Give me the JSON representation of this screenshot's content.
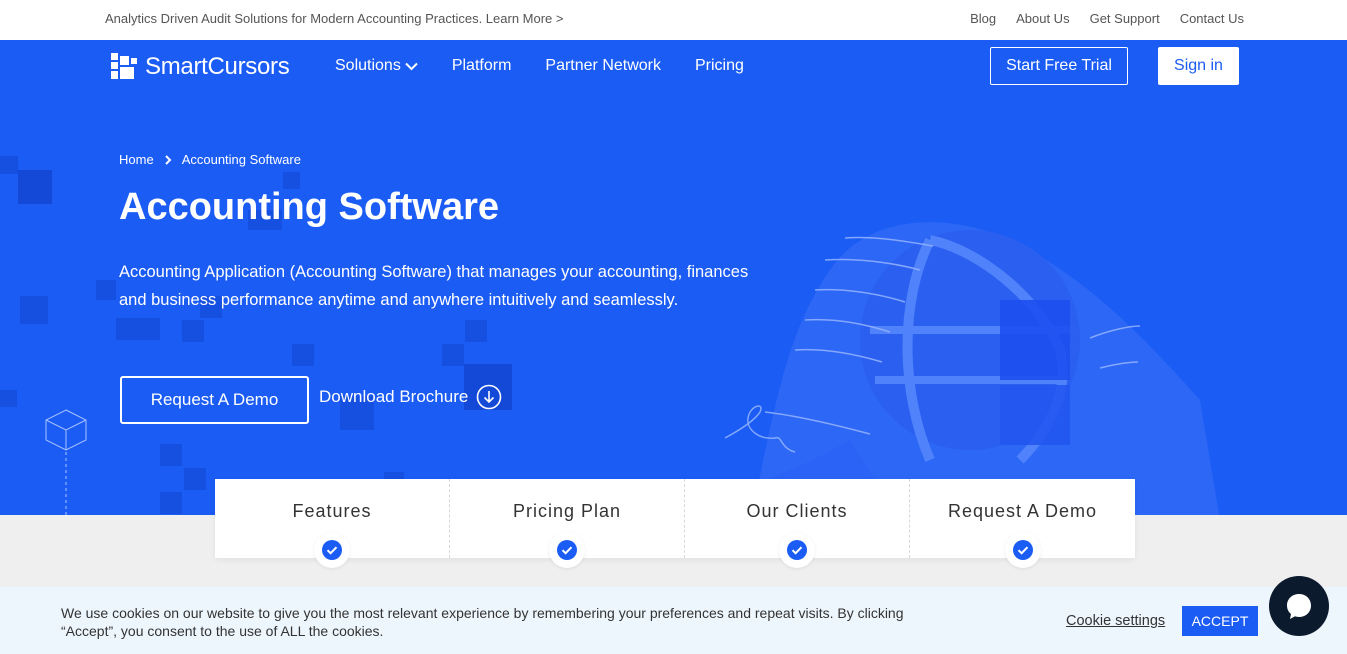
{
  "topbar": {
    "announcement": "Analytics Driven Audit Solutions for Modern Accounting Practices. Learn More >",
    "links": [
      "Blog",
      "About Us",
      "Get Support",
      "Contact Us"
    ]
  },
  "nav": {
    "brand": "SmartCursors",
    "items": [
      {
        "label": "Solutions",
        "has_dropdown": true
      },
      {
        "label": "Platform"
      },
      {
        "label": "Partner Network"
      },
      {
        "label": "Pricing"
      }
    ],
    "trial_label": "Start Free Trial",
    "signin_label": "Sign in"
  },
  "hero": {
    "breadcrumb": [
      "Home",
      "Accounting Software"
    ],
    "title": "Accounting Software",
    "description": "Accounting Application (Accounting Software) that manages your accounting, finances and business performance anytime and anywhere intuitively and seamlessly.",
    "demo_label": "Request A Demo",
    "brochure_label": "Download Brochure"
  },
  "tabs": [
    {
      "label": "Features"
    },
    {
      "label": "Pricing Plan"
    },
    {
      "label": "Our Clients"
    },
    {
      "label": "Request A Demo"
    }
  ],
  "cookie": {
    "message": "We use cookies on our website to give you the most relevant experience by remembering your preferences and repeat visits. By clicking “Accept”, you consent to the use of ALL the cookies.",
    "settings_label": "Cookie settings",
    "accept_label": "ACCEPT"
  },
  "colors": {
    "brand_blue": "#1b5cf5",
    "band_gray": "#efefef",
    "cookie_bg": "#eef6fd",
    "chat_bg": "#0c1a2e"
  },
  "icons": [
    "logo-mark-icon",
    "chevron-down-icon",
    "chevron-right-icon",
    "download-circle-icon",
    "check-circle-icon",
    "chat-bubble-icon",
    "cube-outline-icon"
  ]
}
